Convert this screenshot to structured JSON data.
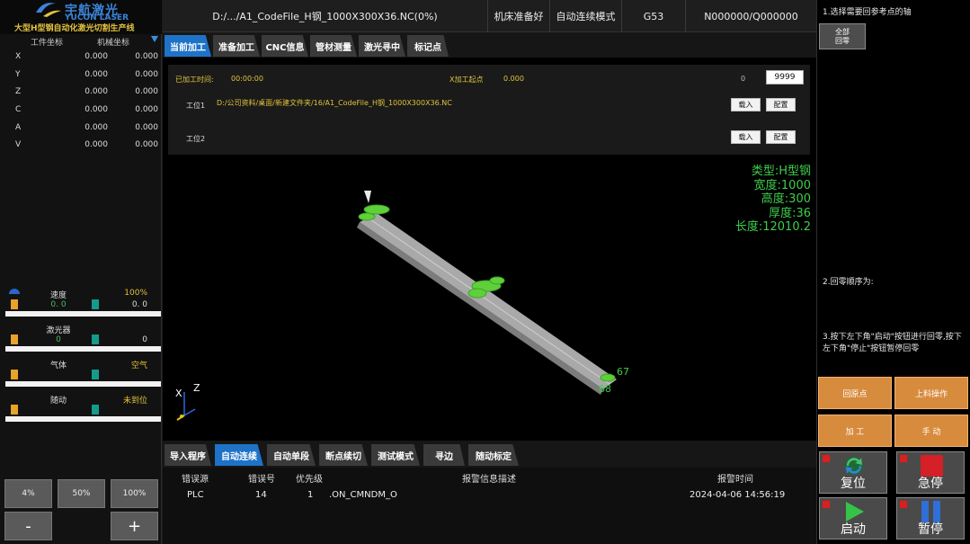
{
  "logo": {
    "brand_cn": "宇航激光",
    "brand_en": "YUCON LASER",
    "tagline": "大型H型钢自动化激光切割生产线"
  },
  "coords": {
    "work_header": "工件坐标",
    "machine_header": "机械坐标",
    "rows": [
      {
        "axis": "X",
        "work": "0.000",
        "machine": "0.000"
      },
      {
        "axis": "Y",
        "work": "0.000",
        "machine": "0.000"
      },
      {
        "axis": "Z",
        "work": "0.000",
        "machine": "0.000"
      },
      {
        "axis": "C",
        "work": "0.000",
        "machine": "0.000"
      },
      {
        "axis": "A",
        "work": "0.000",
        "machine": "0.000"
      },
      {
        "axis": "V",
        "work": "0.000",
        "machine": "0.000"
      }
    ]
  },
  "gauges": [
    {
      "label": "速度",
      "right": "100%",
      "v1": "0. 0",
      "v2": "0. 0"
    },
    {
      "label": "激光器",
      "right": "",
      "v1": "0",
      "v2": "0"
    },
    {
      "label": "气体",
      "right": "空气",
      "v1": "",
      "v2": ""
    },
    {
      "label": "随动",
      "right": "未到位",
      "v1": "",
      "v2": ""
    }
  ],
  "override": {
    "p4": "4%",
    "p50": "50%",
    "p100": "100%",
    "minus": "-",
    "plus": "+"
  },
  "topbar": {
    "file": "D:/.../A1_CodeFile_H钢_1000X300X36.NC(0%)",
    "machine_status": "机床准备好",
    "mode": "自动连续模式",
    "coord_sys": "G53",
    "program_pos": "N000000/Q000000"
  },
  "tabs": [
    {
      "label": "当前加工",
      "active": true
    },
    {
      "label": "准备加工",
      "active": false
    },
    {
      "label": "CNC信息",
      "active": false
    },
    {
      "label": "管材测量",
      "active": false
    },
    {
      "label": "激光寻中",
      "active": false
    },
    {
      "label": "标记点",
      "active": false
    }
  ],
  "info": {
    "time_label": "已加工时间:",
    "time_value": "00:00:00",
    "x_start_label": "X加工起点",
    "x_start_value": "0.000",
    "count_done": "0",
    "count_total": "9999",
    "station1_label": "工位1",
    "station1_path": "D:/公司资料/桌面/新建文件夹/16/A1_CodeFile_H钢_1000X300X36.NC",
    "station2_label": "工位2",
    "load_label": "载入",
    "config_label": "配置"
  },
  "part": {
    "type": "类型:H型钢",
    "width": "宽度:1000",
    "height": "高度:300",
    "thickness": "厚度:36",
    "length": "长度:12010.2"
  },
  "scene": {
    "label_a": "67",
    "label_b": "68",
    "axis_x": "X",
    "axis_z": "Z"
  },
  "bottom_tabs": [
    {
      "label": "导入程序",
      "active": false
    },
    {
      "label": "自动连续",
      "active": true
    },
    {
      "label": "自动单段",
      "active": false
    },
    {
      "label": "断点续切",
      "active": false
    },
    {
      "label": "测试模式",
      "active": false
    },
    {
      "label": "寻边",
      "active": false
    },
    {
      "label": "随动标定",
      "active": false
    }
  ],
  "alarm": {
    "headers": {
      "source": "错误源",
      "code": "错误号",
      "priority": "优先级",
      "desc": "报警信息描述",
      "time": "报警时间"
    },
    "row": {
      "source": "PLC",
      "code": "14",
      "priority": "1",
      "desc": ".ON_CMNDM_O",
      "time": "2024-04-06 14:56:19"
    }
  },
  "right": {
    "step1": "1.选择需要回参考点的轴",
    "home_all_l1": "全部",
    "home_all_l2": "回零",
    "step2": "2.回零顺序为:",
    "step3": "3.按下左下角\"启动\"按钮进行回零,按下左下角\"停止\"按钮暂停回零",
    "btn_origin": "回原点",
    "btn_loading": "上料操作",
    "btn_process": "加  工",
    "btn_manual": "手  动",
    "btn_reset": "复位",
    "btn_estop": "急停",
    "btn_start": "启动",
    "btn_pause": "暂停"
  }
}
